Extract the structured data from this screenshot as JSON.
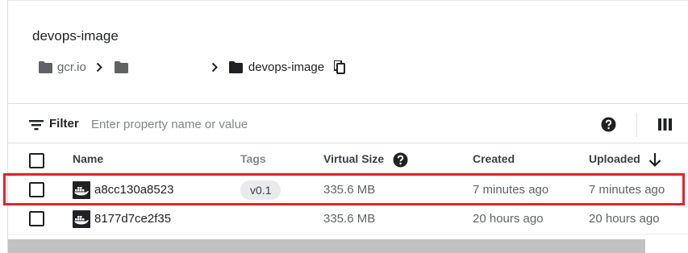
{
  "header": {
    "title": "devops-image",
    "breadcrumb": [
      "gcr.io",
      "",
      "devops-image"
    ]
  },
  "filter": {
    "label": "Filter",
    "placeholder": "Enter property name or value"
  },
  "table": {
    "columns": [
      "Name",
      "Tags",
      "Virtual Size",
      "Created",
      "Uploaded"
    ],
    "sort": {
      "column": "Uploaded",
      "direction": "descending"
    },
    "rows": [
      {
        "name": "a8cc130a8523",
        "tag": "v0.1",
        "size": "335.6 MB",
        "created": "7 minutes ago",
        "uploaded": "7 minutes ago",
        "highlighted": true
      },
      {
        "name": "8177d7ce2f35",
        "tag": "",
        "size": "335.6 MB",
        "created": "20 hours ago",
        "uploaded": "20 hours ago",
        "highlighted": false
      }
    ]
  },
  "colors": {
    "highlight": "#e8202e",
    "text": "#202124",
    "muted": "#5f6368",
    "chip": "#e8eaed"
  },
  "icons": [
    "folder-icon",
    "chevron-right-icon",
    "copy-icon",
    "filter-icon",
    "help-icon",
    "columns-icon",
    "arrow-down-icon",
    "docker-icon"
  ]
}
